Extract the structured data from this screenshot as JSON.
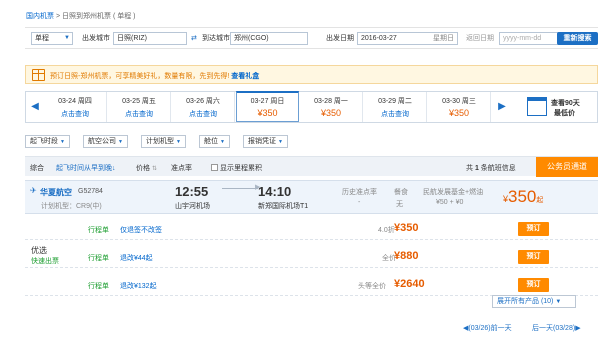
{
  "breadcrumb": {
    "domestic": "国内机票",
    "sep": " > ",
    "route": "日照到郑州机票",
    "type": "( 单程 )"
  },
  "search": {
    "trip_type": "单程",
    "from_label": "出发城市",
    "from_value": "日照(RIZ)",
    "to_label": "到达城市",
    "to_value": "郑州(CGO)",
    "depart_label": "出发日期",
    "depart_value": "2016-03-27",
    "depart_week": "星期日",
    "return_label": "返回日期",
    "return_placeholder": "yyyy-mm-dd",
    "search_button": "重新搜索"
  },
  "promo": {
    "text": "预订日照-郑州机票，可享精美好礼，数量有限，先到先得! ",
    "link": "查看礼盒"
  },
  "dates": [
    {
      "date": "03-24 周四",
      "sub": "点击查询",
      "price": ""
    },
    {
      "date": "03-25 周五",
      "sub": "点击查询",
      "price": ""
    },
    {
      "date": "03-26 周六",
      "sub": "点击查询",
      "price": ""
    },
    {
      "date": "03-27 周日",
      "sub": "",
      "price": "¥350"
    },
    {
      "date": "03-28 周一",
      "sub": "",
      "price": "¥350"
    },
    {
      "date": "03-29 周二",
      "sub": "点击查询",
      "price": ""
    },
    {
      "date": "03-30 周三",
      "sub": "",
      "price": "¥350"
    }
  ],
  "calendar": {
    "line1": "查看90天",
    "line2": "最低价"
  },
  "filters": [
    "起飞时段",
    "航空公司",
    "计划机型",
    "舱位",
    "报销凭证"
  ],
  "sortbar": {
    "all": "综合",
    "depart": "起飞时间从早到晚",
    "price": "价格",
    "ontime": "准点率",
    "mileage": "显示里程累积",
    "count_prefix": "共 ",
    "count": "1",
    "count_suffix": " 条航班信息",
    "gov": "公务员通道"
  },
  "flight": {
    "airline": "华夏航空",
    "flight_no": "G52784",
    "plane": "计划机型：CR9(中)",
    "dep_time": "12:55",
    "dep_airport": "山宇河机场",
    "arr_time": "14:10",
    "arr_airport": "新郑国际机场T1",
    "ontime_label": "历史准点率",
    "ontime_value": "-",
    "meal_label": "餐食",
    "meal_value": "无",
    "tax_label": "民航发展基金+燃油",
    "tax_value": "¥50 + ¥0",
    "price_symbol": "¥",
    "price": "350",
    "price_suffix": "起"
  },
  "offers": {
    "group_label": "优选",
    "group_sub": "快速出票",
    "rows": [
      {
        "tag": "行程单",
        "desc": "仅退签不改签",
        "discount": "4.0折",
        "price": "¥350",
        "book": "预订"
      },
      {
        "tag": "行程单",
        "desc": "退改¥44起",
        "discount": "全价",
        "price": "¥880",
        "book": "预订"
      },
      {
        "tag": "行程单",
        "desc": "退改¥132起",
        "discount": "头等全价",
        "price": "¥2640",
        "book": "预订"
      }
    ]
  },
  "more": "展开所有产品 (10)",
  "pager": {
    "prev": "(03/26)前一天",
    "next": "后一天(03/28)"
  },
  "colors": {
    "accent": "#1c6fc4",
    "orange": "#ff8a00",
    "price": "#e65c00"
  }
}
